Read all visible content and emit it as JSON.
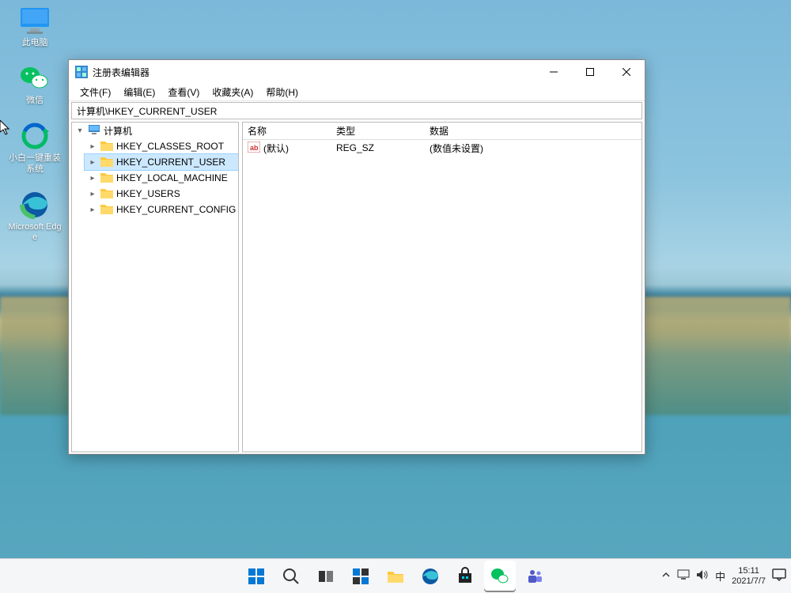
{
  "desktop_icons": [
    {
      "key": "this-pc",
      "label": "此电脑"
    },
    {
      "key": "wechat",
      "label": "微信"
    },
    {
      "key": "xiaobai",
      "label": "小白一键重装系统"
    },
    {
      "key": "edge",
      "label": "Microsoft Edge"
    }
  ],
  "window": {
    "title": "注册表编辑器",
    "menu": [
      "文件(F)",
      "编辑(E)",
      "查看(V)",
      "收藏夹(A)",
      "帮助(H)"
    ],
    "address": "计算机\\HKEY_CURRENT_USER",
    "tree_root": "计算机",
    "tree_children": [
      {
        "label": "HKEY_CLASSES_ROOT",
        "selected": false
      },
      {
        "label": "HKEY_CURRENT_USER",
        "selected": true
      },
      {
        "label": "HKEY_LOCAL_MACHINE",
        "selected": false
      },
      {
        "label": "HKEY_USERS",
        "selected": false
      },
      {
        "label": "HKEY_CURRENT_CONFIG",
        "selected": false
      }
    ],
    "list_columns": {
      "name": "名称",
      "type": "类型",
      "data": "数据"
    },
    "list_rows": [
      {
        "name": "(默认)",
        "type": "REG_SZ",
        "data": "(数值未设置)"
      }
    ]
  },
  "taskbar": {
    "ime": "中",
    "time": "15:11",
    "date": "2021/7/7"
  }
}
